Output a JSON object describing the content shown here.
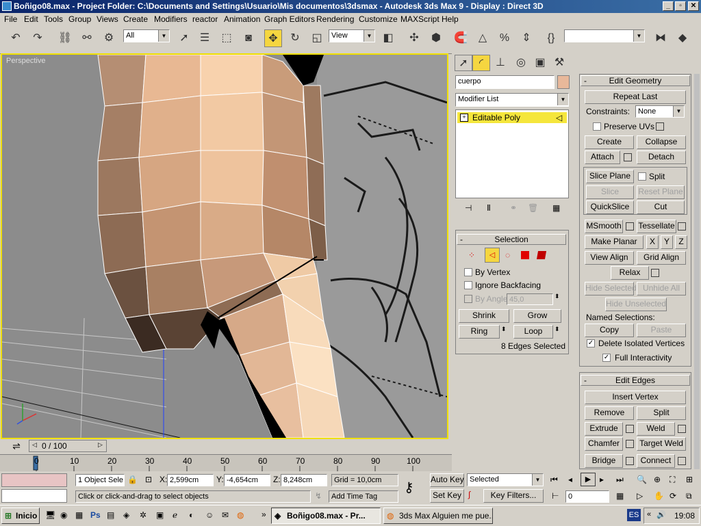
{
  "window": {
    "title": "Boñigo08.max     - Project Folder: C:\\Documents and Settings\\Usuario\\Mis documentos\\3dsmax     - Autodesk 3ds Max 9       - Display : Direct 3D",
    "min": "_",
    "max": "▫",
    "close": "✕"
  },
  "menu": [
    "File",
    "Edit",
    "Tools",
    "Group",
    "Views",
    "Create",
    "Modifiers",
    "reactor",
    "Animation",
    "Graph Editors",
    "Rendering",
    "Customize",
    "MAXScript",
    "Help"
  ],
  "toolbar": {
    "selection_filter": "All",
    "ref_coord": "View",
    "named_sel_set": ""
  },
  "viewport": {
    "label": "Perspective"
  },
  "command_panel": {
    "object_name": "cuerpo",
    "object_color": "#e8b89a",
    "modifier_list": "Modifier List",
    "stack_item": "Editable Poly",
    "edit_geometry": {
      "header": "Edit Geometry",
      "repeat_last": "Repeat Last",
      "constraints_label": "Constraints:",
      "constraints_value": "None",
      "preserve_uvs": "Preserve UVs",
      "create": "Create",
      "collapse": "Collapse",
      "attach": "Attach",
      "detach": "Detach",
      "slice_plane": "Slice Plane",
      "split": "Split",
      "slice": "Slice",
      "reset_plane": "Reset Plane",
      "quickslice": "QuickSlice",
      "cut": "Cut",
      "msmooth": "MSmooth",
      "tessellate": "Tessellate",
      "make_planar": "Make Planar",
      "x": "X",
      "y": "Y",
      "z": "Z",
      "view_align": "View Align",
      "grid_align": "Grid Align",
      "relax": "Relax",
      "hide_selected": "Hide Selected",
      "unhide_all": "Unhide All",
      "hide_unselected": "Hide Unselected",
      "named_selections": "Named Selections:",
      "copy": "Copy",
      "paste": "Paste",
      "delete_isolated": "Delete Isolated Vertices",
      "full_interactivity": "Full Interactivity"
    },
    "selection": {
      "header": "Selection",
      "by_vertex": "By Vertex",
      "ignore_backfacing": "Ignore Backfacing",
      "by_angle": "By Angle:",
      "angle_value": "45,0",
      "shrink": "Shrink",
      "grow": "Grow",
      "ring": "Ring",
      "loop": "Loop",
      "status": "8 Edges Selected"
    },
    "edit_edges": {
      "header": "Edit Edges",
      "insert_vertex": "Insert Vertex",
      "remove": "Remove",
      "split": "Split",
      "extrude": "Extrude",
      "weld": "Weld",
      "chamfer": "Chamfer",
      "target_weld": "Target Weld",
      "bridge": "Bridge",
      "connect": "Connect"
    }
  },
  "timeline": {
    "frame": "0 / 100",
    "ticks": [
      "0",
      "10",
      "20",
      "30",
      "40",
      "50",
      "60",
      "70",
      "80",
      "90",
      "100"
    ]
  },
  "status": {
    "objects": "1 Object Sele",
    "x_label": "X:",
    "x": "2,599cm",
    "y_label": "Y:",
    "y": "-4,654cm",
    "z_label": "Z:",
    "z": "8,248cm",
    "grid": "Grid = 10,0cm",
    "prompt": "Click or click-and-drag to select objects",
    "add_time_tag": "Add Time Tag",
    "auto_key": "Auto Key",
    "set_key": "Set Key",
    "key_mode": "Selected",
    "key_filters": "Key Filters...",
    "current_frame": "0"
  },
  "taskbar": {
    "start": "Inicio",
    "tasks": [
      "Boñigo08.max     - Pr...",
      "3ds Max Alguien me pue..."
    ],
    "lang": "ES",
    "clock": "19:08"
  }
}
